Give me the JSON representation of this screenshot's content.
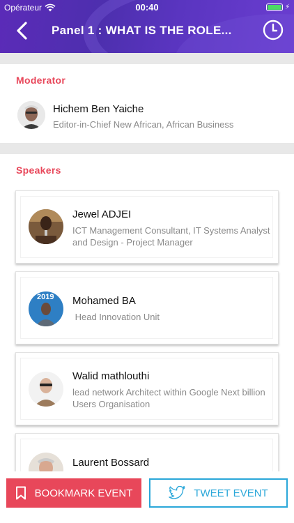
{
  "status_bar": {
    "carrier": "Opérateur",
    "time": "00:40"
  },
  "header": {
    "title": "Panel 1 :  WHAT IS THE ROLE...",
    "back_icon": "chevron-left-icon",
    "history_icon": "clock-icon"
  },
  "moderator_section": {
    "title": "Moderator",
    "person": {
      "name": "Hichem Ben Yaiche",
      "role": "Editor-in-Chief New African, African Business"
    }
  },
  "speakers_section": {
    "title": "Speakers",
    "speakers": [
      {
        "name": "Jewel ADJEI",
        "role": "ICT Management Consultant, IT Systems Analyst and Design - Project Manager"
      },
      {
        "name": "Mohamed BA",
        "role": " Head Innovation Unit",
        "avatar_badge": "2019"
      },
      {
        "name": "Walid mathlouthi",
        "role": "lead network Architect within Google Next billion Users Organisation"
      },
      {
        "name": "Laurent Bossard",
        "role": ""
      }
    ]
  },
  "actions": {
    "bookmark_label": "BOOKMARK EVENT",
    "tweet_label": "TWEET EVENT"
  },
  "colors": {
    "accent": "#e8475a",
    "twitter": "#2aa7d9",
    "header": "#5b2bb8"
  }
}
